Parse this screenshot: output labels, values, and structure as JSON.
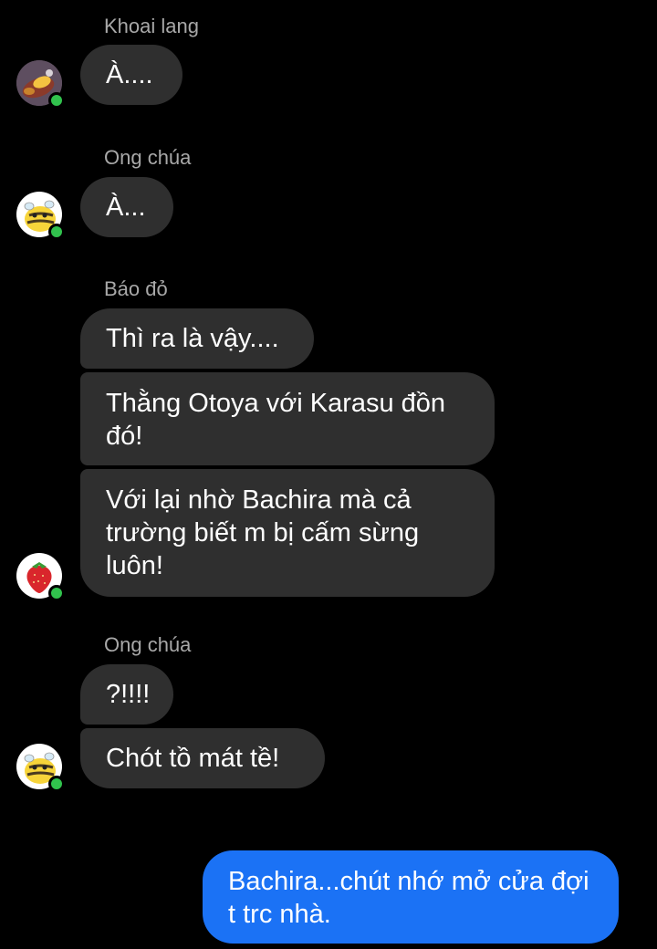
{
  "colors": {
    "background": "#000000",
    "incoming_bubble": "#2f2f2f",
    "outgoing_bubble": "#1b72f5",
    "sender_name": "#a8a8a8",
    "online_dot": "#31c24d"
  },
  "messages": [
    {
      "sender": "Khoai lang",
      "avatar": "sweet-potato-avatar",
      "online": true,
      "text": "À...."
    },
    {
      "sender": "Ong chúa",
      "avatar": "bee-avatar",
      "online": true,
      "text": "À..."
    },
    {
      "sender": "Báo đỏ",
      "avatar": "strawberry-avatar",
      "online": true,
      "texts": [
        "Thì ra là vậy....",
        "Thằng Otoya với Karasu đồn đó!",
        "Với lại nhờ Bachira mà cả trường biết m bị cấm sừng luôn!"
      ]
    },
    {
      "sender": "Ong chúa",
      "avatar": "bee-avatar",
      "online": true,
      "texts": [
        "?!!!!",
        "Chót tồ mát tề!"
      ]
    },
    {
      "sender": "me",
      "outgoing": true,
      "text": "Bachira...chút nhớ mở cửa đợi t trc nhà."
    }
  ]
}
